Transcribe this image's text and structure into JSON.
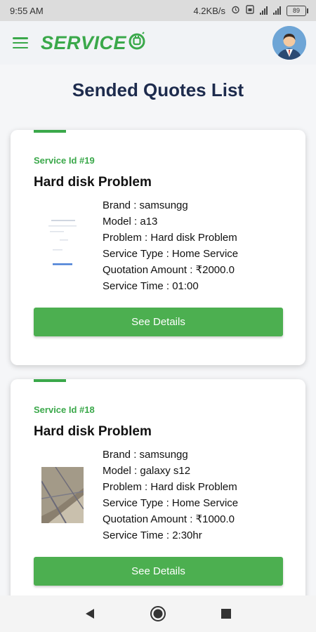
{
  "status_bar": {
    "time": "9:55 AM",
    "speed": "4.2KB/s",
    "battery": "89"
  },
  "app_bar": {
    "brand": "SERVICE"
  },
  "page": {
    "title": "Sended Quotes List"
  },
  "quotes": [
    {
      "service_id": "Service Id #19",
      "title": "Hard disk Problem",
      "brand": "Brand : samsungg",
      "model": "Model : a13",
      "problem": "Problem : Hard disk Problem",
      "service_type": "Service Type : Home Service",
      "quotation_amount": "Quotation Amount : ₹2000.0",
      "service_time": "Service Time : 01:00",
      "button_label": "See Details"
    },
    {
      "service_id": "Service Id #18",
      "title": "Hard disk Problem",
      "brand": "Brand : samsungg",
      "model": "Model : galaxy s12",
      "problem": "Problem : Hard disk Problem",
      "service_type": "Service Type : Home Service",
      "quotation_amount": "Quotation Amount : ₹1000.0",
      "service_time": "Service Time : 2:30hr",
      "button_label": "See Details"
    }
  ],
  "colors": {
    "accent": "#3aa84a",
    "button": "#4caf50",
    "title": "#1d2b4d"
  },
  "icons": {
    "menu": "hamburger-menu-icon",
    "logo": "plug-icon",
    "back": "back-triangle-icon",
    "home": "home-circle-icon",
    "recents": "recents-square-icon"
  }
}
